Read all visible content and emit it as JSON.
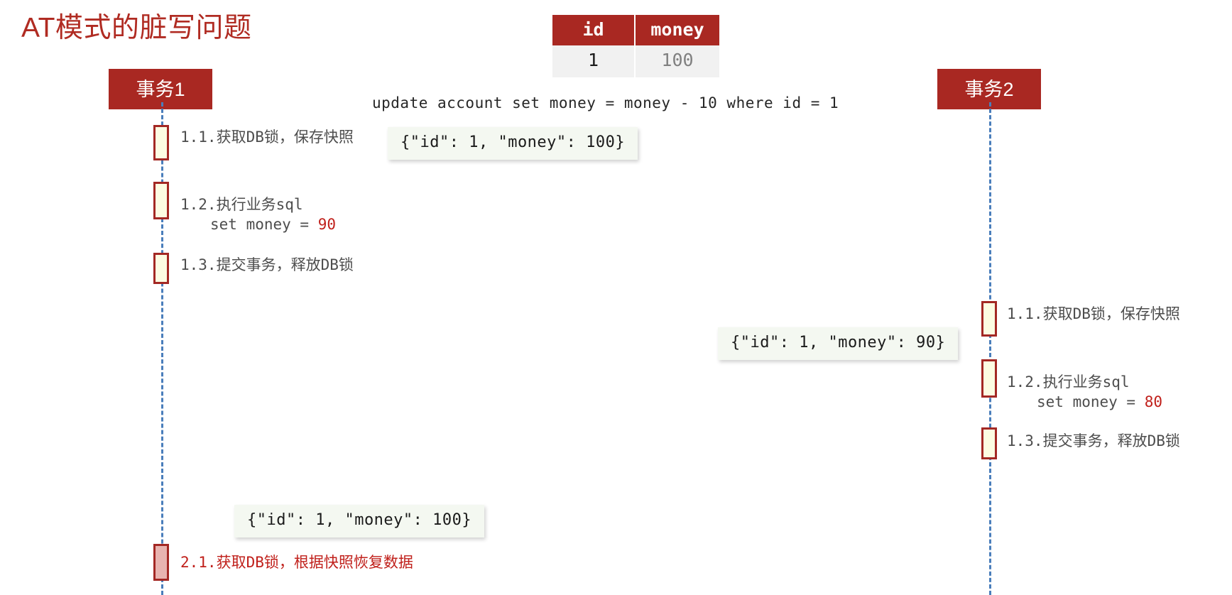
{
  "title": "AT模式的脏写问题",
  "theme": {
    "brand_red": "#A92822",
    "title_red": "#B02B22",
    "lifeline_blue": "#4A7EBB",
    "activation_fill": "#FCFCE2",
    "rollback_fill": "#E8B4B0",
    "json_box_bg": "#F4F8F1",
    "value_red": "#C0201B"
  },
  "account_table": {
    "headers": [
      "id",
      "money"
    ],
    "rows": [
      [
        "1",
        "100"
      ]
    ]
  },
  "sql": "update account set money = money - 10 where id = 1",
  "participants": [
    {
      "id": "tx1",
      "label": "事务1"
    },
    {
      "id": "tx2",
      "label": "事务2"
    }
  ],
  "tx1_steps": [
    {
      "text": "1.1.获取DB锁，保存快照"
    },
    {
      "text": "1.2.执行业务sql",
      "sub_prefix": "set money = ",
      "sub_value": "90"
    },
    {
      "text": "1.3.提交事务，释放DB锁"
    },
    {
      "text": "2.1.获取DB锁，根据快照恢复数据"
    }
  ],
  "tx2_steps": [
    {
      "text": "1.1.获取DB锁，保存快照"
    },
    {
      "text": "1.2.执行业务sql",
      "sub_prefix": "set money = ",
      "sub_value": "80"
    },
    {
      "text": "1.3.提交事务，释放DB锁"
    }
  ],
  "json_boxes": [
    {
      "id": "tx1-snapshot",
      "text": "{\"id\": 1, \"money\": 100}"
    },
    {
      "id": "tx2-snapshot",
      "text": "{\"id\": 1, \"money\": 90}"
    },
    {
      "id": "tx1-rollback-snapshot",
      "text": "{\"id\": 1, \"money\": 100}"
    }
  ]
}
